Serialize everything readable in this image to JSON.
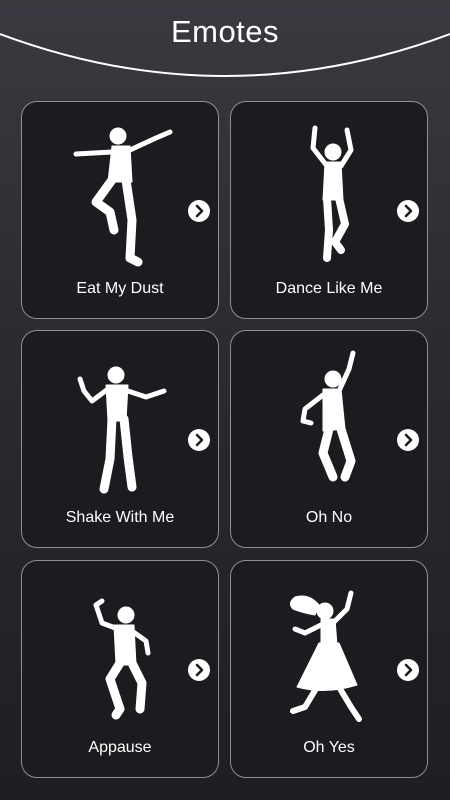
{
  "header": {
    "title": "Emotes"
  },
  "emotes": [
    {
      "label": "Eat My Dust",
      "figure_icon": "dancer-kick-icon"
    },
    {
      "label": "Dance Like Me",
      "figure_icon": "dancer-arms-up-icon"
    },
    {
      "label": "Shake With Me",
      "figure_icon": "dancer-arms-out-icon"
    },
    {
      "label": "Oh No",
      "figure_icon": "dancer-reach-icon"
    },
    {
      "label": "Appause",
      "figure_icon": "dancer-clap-icon"
    },
    {
      "label": "Oh Yes",
      "figure_icon": "dancer-dress-icon"
    }
  ],
  "colors": {
    "card_border": "#8f8e95",
    "card_bg": "#1c1b1f",
    "accent": "#ffffff"
  }
}
